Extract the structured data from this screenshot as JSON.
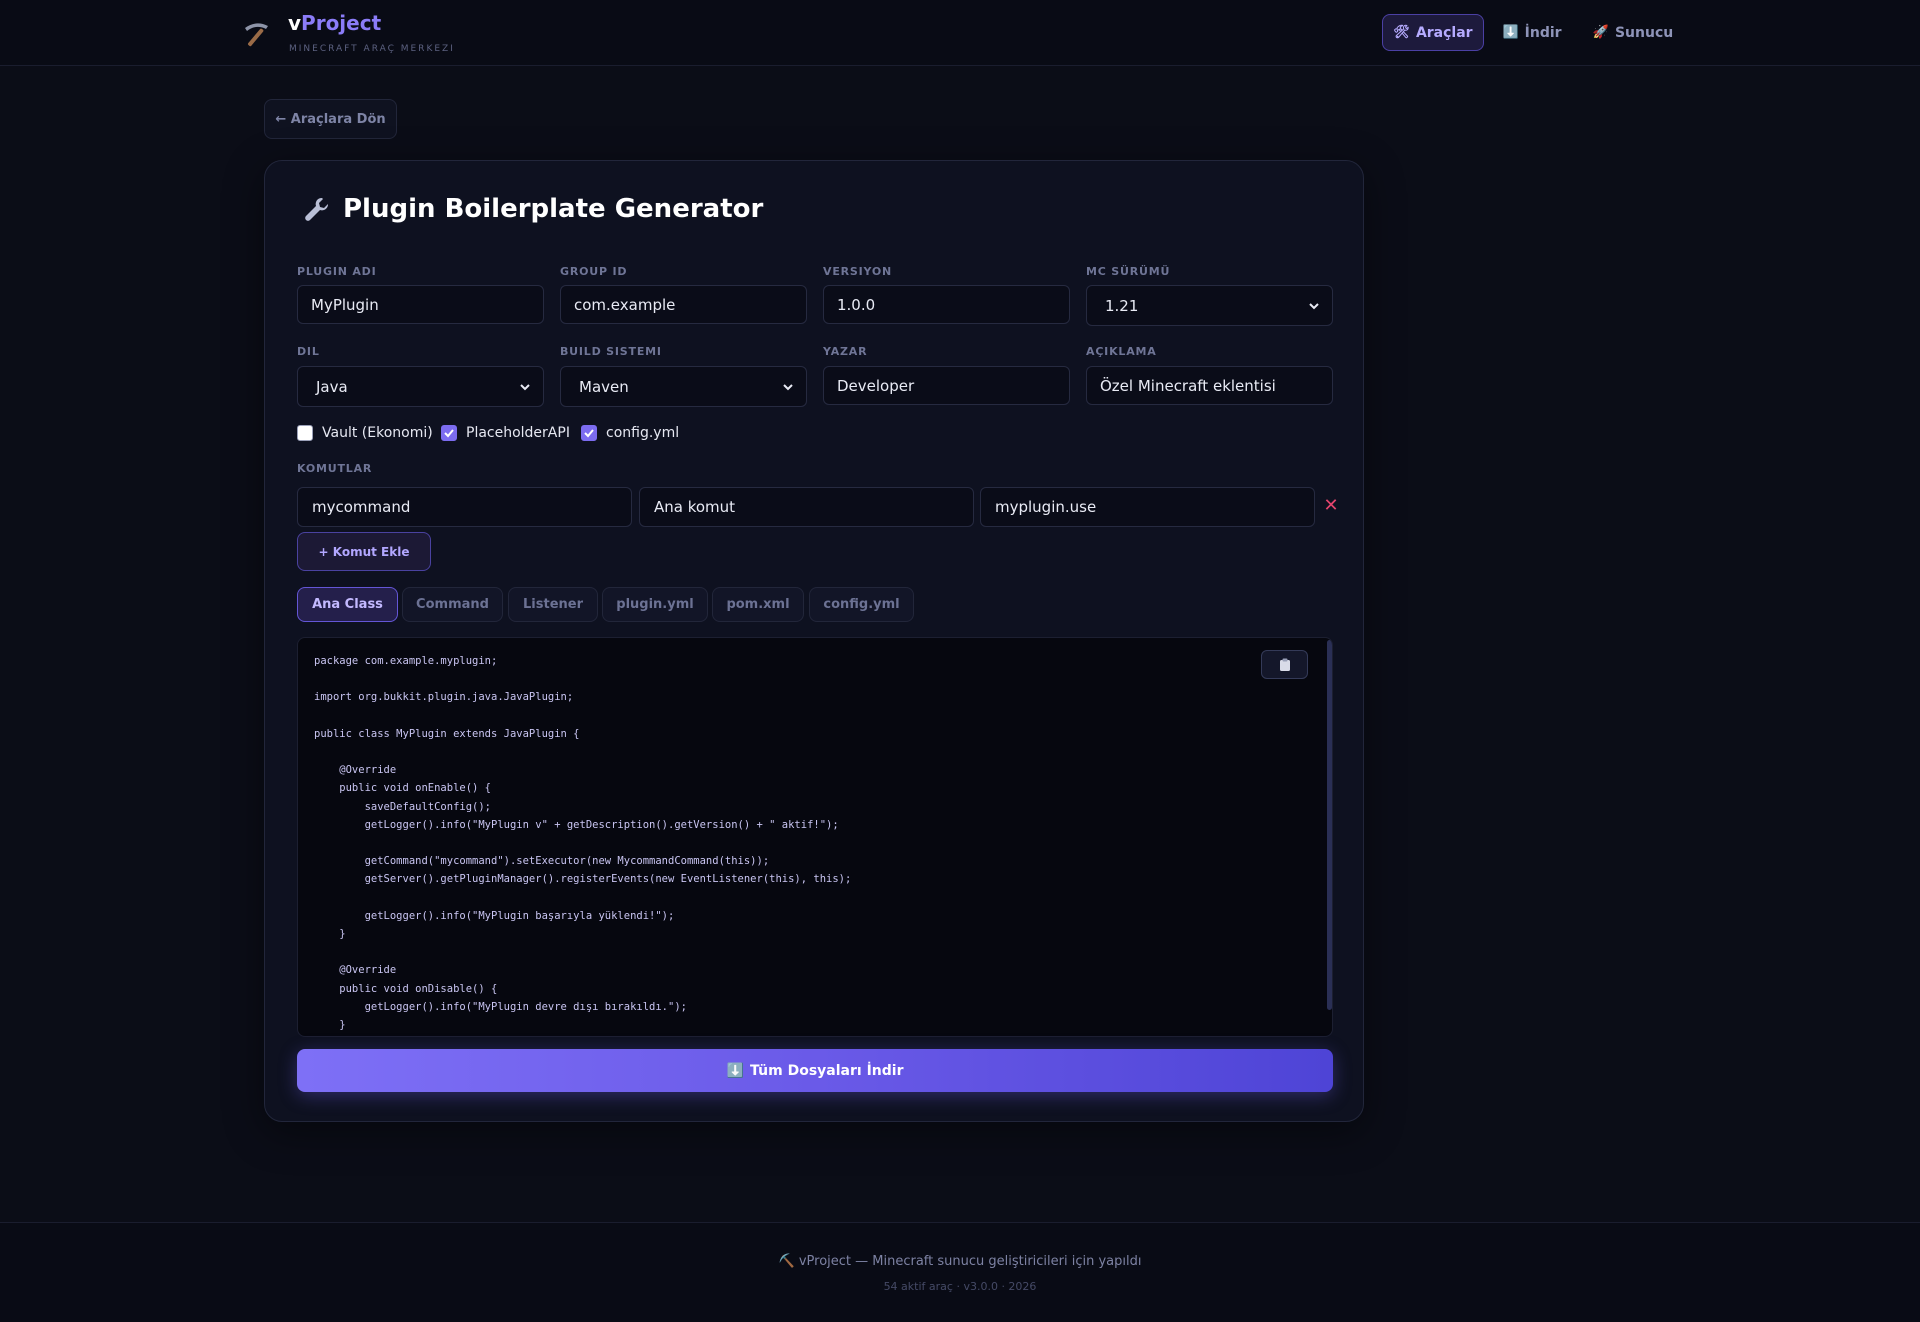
{
  "header": {
    "brand_prefix": "v",
    "brand_name": "Project",
    "subtitle": "MINECRAFT ARAÇ MERKEZI",
    "nav": [
      {
        "label": "Araçlar",
        "icon": "tools-icon",
        "active": true
      },
      {
        "label": "İndir",
        "icon": "download-icon",
        "active": false
      },
      {
        "label": "Sunucu",
        "icon": "rocket-icon",
        "active": false
      }
    ]
  },
  "back_button": "← Araçlara Dön",
  "card": {
    "title": "Plugin Boilerplate Generator",
    "fields": {
      "plugin_name": {
        "label": "PLUGIN ADI",
        "value": "MyPlugin"
      },
      "group_id": {
        "label": "GROUP ID",
        "value": "com.example"
      },
      "version": {
        "label": "VERSIYON",
        "value": "1.0.0"
      },
      "mc_version": {
        "label": "MC SÜRÜMÜ",
        "value": "1.21"
      },
      "language": {
        "label": "DIL",
        "value": "Java"
      },
      "build_system": {
        "label": "BUILD SISTEMI",
        "value": "Maven"
      },
      "author": {
        "label": "YAZAR",
        "value": "Developer"
      },
      "description": {
        "label": "AÇIKLAMA",
        "value": "Özel Minecraft eklentisi"
      }
    },
    "options": [
      {
        "label": "Vault (Ekonomi)",
        "checked": false
      },
      {
        "label": "PlaceholderAPI",
        "checked": true
      },
      {
        "label": "config.yml",
        "checked": true
      }
    ],
    "commands_label": "KOMUTLAR",
    "commands": [
      {
        "name": "mycommand",
        "description": "Ana komut",
        "permission": "myplugin.use"
      }
    ],
    "add_command_label": "+ Komut Ekle",
    "tabs": [
      "Ana Class",
      "Command",
      "Listener",
      "plugin.yml",
      "pom.xml",
      "config.yml"
    ],
    "active_tab": "Ana Class",
    "code": "package com.example.myplugin;\n\nimport org.bukkit.plugin.java.JavaPlugin;\n\npublic class MyPlugin extends JavaPlugin {\n\n    @Override\n    public void onEnable() {\n        saveDefaultConfig();\n        getLogger().info(\"MyPlugin v\" + getDescription().getVersion() + \" aktif!\");\n\n        getCommand(\"mycommand\").setExecutor(new MycommandCommand(this));\n        getServer().getPluginManager().registerEvents(new EventListener(this), this);\n\n        getLogger().info(\"MyPlugin başarıyla yüklendi!\");\n    }\n\n    @Override\n    public void onDisable() {\n        getLogger().info(\"MyPlugin devre dışı bırakıldı.\");\n    }",
    "download_all_label": "Tüm Dosyaları İndir"
  },
  "footer": {
    "main": "vProject — Minecraft sunucu geliştiricileri için yapıldı",
    "sub": "54 aktif araç · v3.0.0 · 2026"
  },
  "colors": {
    "accent": "#8b7cf8",
    "danger": "#e5446d",
    "background": "#0b0d17"
  }
}
